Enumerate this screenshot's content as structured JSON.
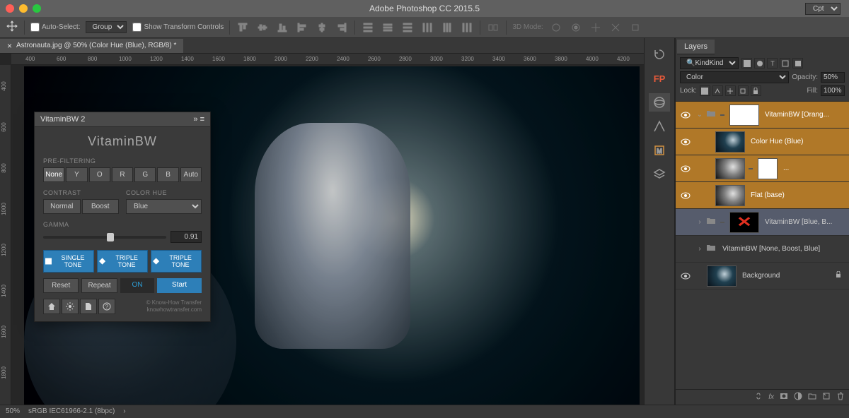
{
  "app_title": "Adobe Photoshop CC 2015.5",
  "workspace_select": "Cpt",
  "optbar": {
    "auto_select_label": "Auto-Select:",
    "target_select": "Group",
    "show_transform_label": "Show Transform Controls",
    "mode3d_label": "3D Mode:"
  },
  "doc_tab": "Astronauta.jpg @ 50% (Color Hue (Blue), RGB/8) *",
  "ruler_marks": [
    "400",
    "600",
    "800",
    "1000",
    "1200",
    "1400",
    "1600",
    "1800",
    "2000",
    "2200",
    "2400",
    "2600",
    "2800",
    "3000",
    "3200",
    "3400",
    "3600",
    "3800",
    "4000",
    "4200"
  ],
  "ruler_v_marks": [
    "400",
    "600",
    "800",
    "1000",
    "1200",
    "1400",
    "1600",
    "1800"
  ],
  "plugin": {
    "name": "VitaminBW 2",
    "title": "VitaminBW",
    "prefilter_label": "PRE-FILTERING",
    "filters": [
      "None",
      "Y",
      "O",
      "R",
      "G",
      "B",
      "Auto"
    ],
    "contrast_label": "CONTRAST",
    "contrast_opts": [
      "Normal",
      "Boost"
    ],
    "colorhue_label": "COLOR HUE",
    "colorhue_value": "Blue",
    "gamma_label": "GAMMA",
    "gamma_value": "0.91",
    "single_tone": "SINGLE TONE",
    "triple_tone": "TRIPLE TONE",
    "reset": "Reset",
    "repeat": "Repeat",
    "toggle": "ON",
    "start": "Start",
    "credit1": "© Know-How Transfer",
    "credit2": "knowhowtransfer.com"
  },
  "layers_panel": {
    "tab": "Layers",
    "kind_label": "Kind",
    "blend_mode": "Color",
    "opacity_label": "Opacity:",
    "opacity_value": "50%",
    "lock_label": "Lock:",
    "fill_label": "Fill:",
    "fill_value": "100%",
    "layers": [
      {
        "name": "VitaminBW [Orang..."
      },
      {
        "name": "Color Hue (Blue)"
      },
      {
        "name": "..."
      },
      {
        "name": "Flat (base)"
      },
      {
        "name": "VitaminBW [Blue, B..."
      },
      {
        "name": "VitaminBW [None, Boost, Blue]"
      },
      {
        "name": "Background"
      }
    ]
  },
  "status": {
    "zoom": "50%",
    "profile": "sRGB IEC61966-2.1 (8bpc)"
  }
}
